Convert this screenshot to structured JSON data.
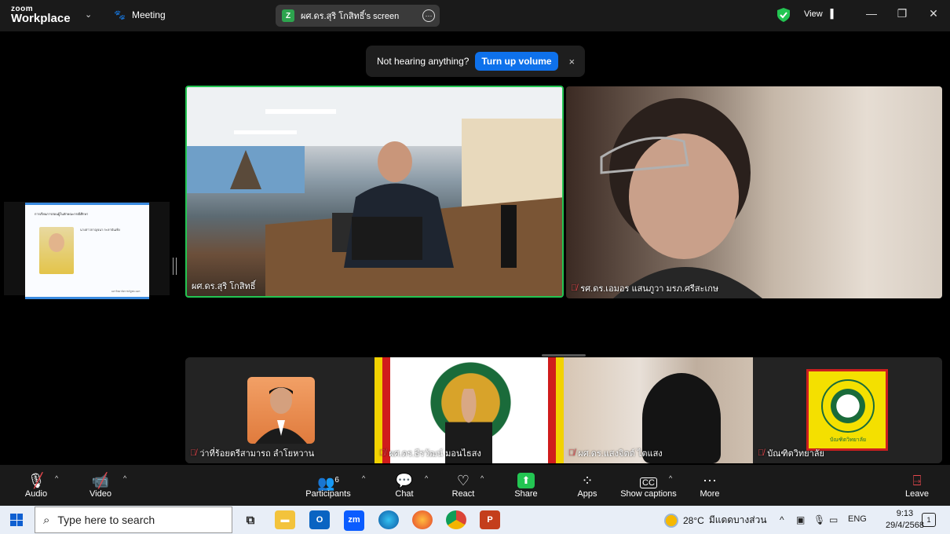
{
  "app": {
    "brand_top": "zoom",
    "brand_bottom": "Workplace",
    "meeting_label": "Meeting",
    "screen_share_label": "ผศ.ดร.สุริ โกสิทธิ์'s screen",
    "view_label": "View"
  },
  "notice": {
    "text": "Not hearing anything?",
    "button": "Turn up volume",
    "close": "×"
  },
  "shared_slide": {
    "title": "การเรียนการสอนผู้ในลักษณะกรณีศึกษา",
    "text": "นางสาวกาญจนา กะลาบันเทิง",
    "footer": "มหาวิทยาลัยราชภัฏพระนคร"
  },
  "participants": {
    "speaker": "ผศ.ดร.สุริ โกสิทธิ์",
    "woman": "รศ.ดร.เอมอร แสนภูวา มรภ.ศรีสะเกษ",
    "gallery": [
      {
        "name": "ว่าที่ร้อยตรีสามารถ ลำโยหวาน"
      },
      {
        "name": "ผศ.ดร.ธีรวัฒน์ มอนไธสง"
      },
      {
        "name": "ผศ.ดร.แสงจิตต์ ไตแสง"
      },
      {
        "name": "บัณฑิตวิทยาลัย"
      }
    ],
    "logo_caption": "บัณฑิตวิทยาลัย"
  },
  "toolbar": {
    "audio": "Audio",
    "video": "Video",
    "participants": "Participants",
    "participants_count": "6",
    "chat": "Chat",
    "react": "React",
    "share": "Share",
    "apps": "Apps",
    "captions": "Show captions",
    "captions_icon": "CC",
    "more": "More",
    "leave": "Leave"
  },
  "taskbar": {
    "search_placeholder": "Type here to search",
    "zoom_app": "zm",
    "weather_temp": "28°C",
    "weather_desc": "มีแดดบางส่วน",
    "lang": "ENG",
    "time": "9:13",
    "date": "29/4/2568",
    "notification_count": "1"
  },
  "colors": {
    "active_speaker": "#23c552",
    "primary_button": "#0e71eb",
    "share_green": "#23c552",
    "mic_muted": "#e5484d"
  }
}
